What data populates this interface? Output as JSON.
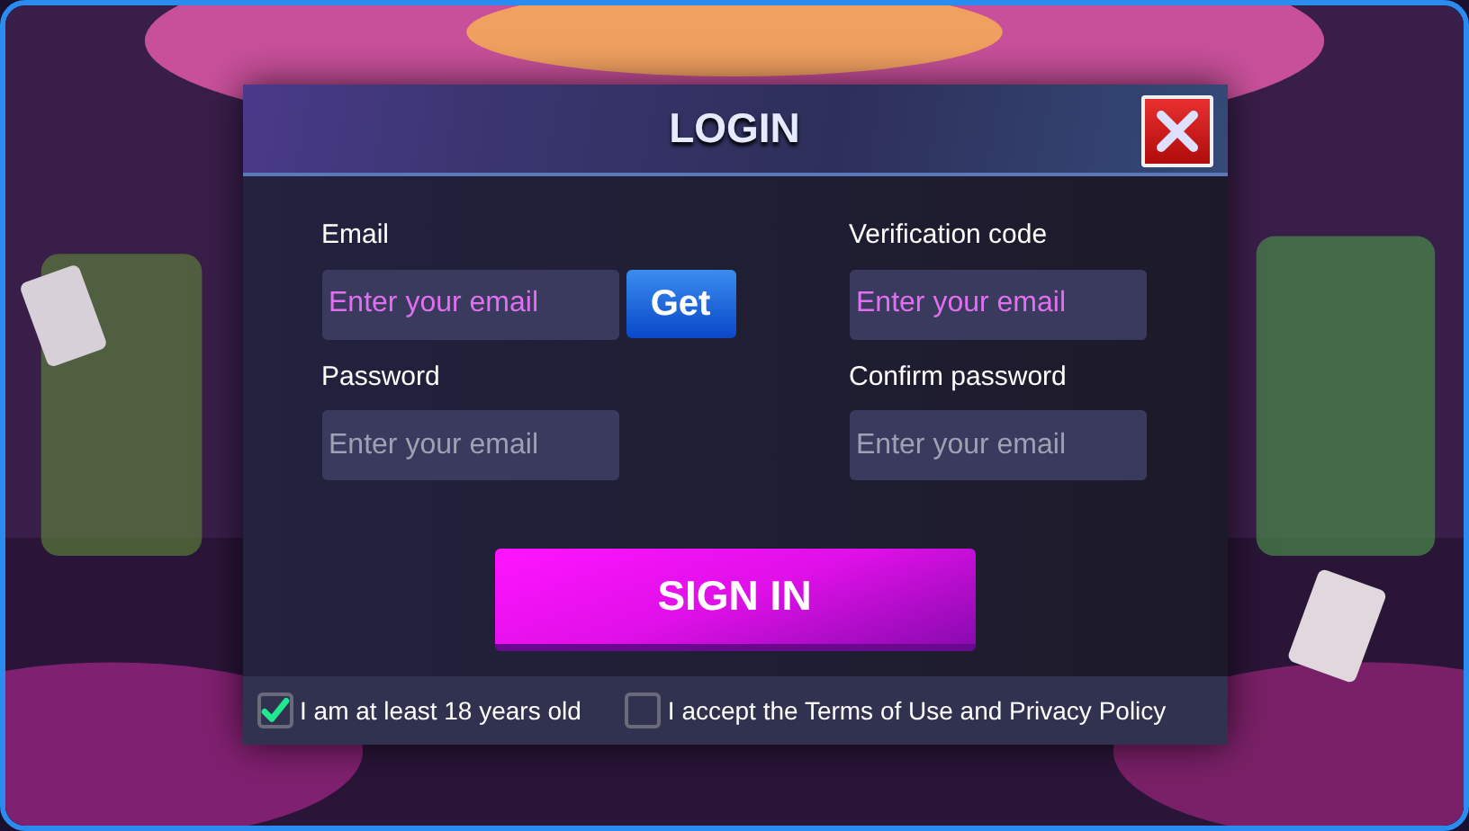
{
  "dialog": {
    "title": "LOGIN"
  },
  "fields": [
    {
      "label": "Email",
      "placeholder": "Enter your email",
      "highlighted": true,
      "button": "Get"
    },
    {
      "label": "Verification code",
      "placeholder": "Enter your email",
      "highlighted": true
    },
    {
      "label": "Password",
      "placeholder": "Enter your email",
      "highlighted": false
    },
    {
      "label": "Confirm password",
      "placeholder": "Enter your email",
      "highlighted": false
    }
  ],
  "submit": "SIGN IN",
  "agreements": [
    {
      "label": "I am at least 18 years old",
      "checked": true
    },
    {
      "label": "I accept the Terms of Use and Privacy Policy",
      "checked": false
    }
  ]
}
